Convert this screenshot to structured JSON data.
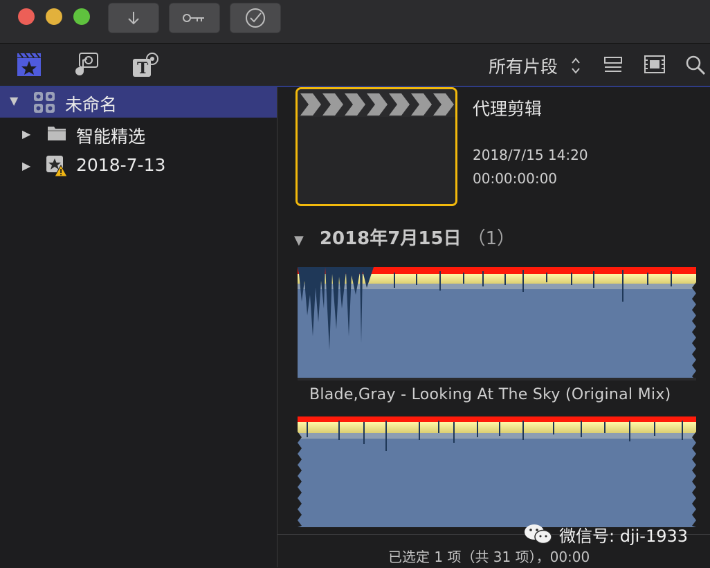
{
  "window": {
    "traffic_colors": [
      "#ec5f57",
      "#e2b13c",
      "#5fc23e"
    ],
    "toolbar_buttons": [
      "import-icon",
      "keyword-icon",
      "analyze-icon"
    ]
  },
  "toolbar": {
    "library_tabs": [
      "libraries-icon",
      "photos-audio-icon",
      "titles-generators-icon"
    ],
    "clip_filter": "所有片段",
    "icons": [
      "filter-chevron-icon",
      "list-view-icon",
      "filmstrip-view-icon",
      "search-icon"
    ]
  },
  "sidebar": {
    "items": [
      {
        "label": "未命名",
        "level": 0,
        "expanded": true,
        "selected": true,
        "icon": "library-icon"
      },
      {
        "label": "智能精选",
        "level": 1,
        "expanded": false,
        "selected": false,
        "icon": "folder-icon"
      },
      {
        "label": "2018-7-13",
        "level": 1,
        "expanded": false,
        "selected": false,
        "icon": "event-warning-icon"
      }
    ]
  },
  "browser": {
    "project": {
      "title": "代理剪辑",
      "date": "2018/7/15 14:20",
      "duration": "00:00:00:00"
    },
    "group": {
      "date": "2018年7月15日",
      "count": "（1）"
    },
    "clips": [
      {
        "name": "Blade,Gray - Looking At The Sky (Original Mix)"
      }
    ],
    "waveform_colors": {
      "body": "#5f7aa3",
      "yellow": "#e8de7e",
      "peak": "#ff1b0a",
      "line": "#1f3858"
    }
  },
  "status": {
    "text": "已选定 1 项（共 31 项），00:00"
  },
  "watermark": {
    "text": "微信号: dji-1933"
  },
  "selection_color": "#f2b90c",
  "accent": "#363b80"
}
